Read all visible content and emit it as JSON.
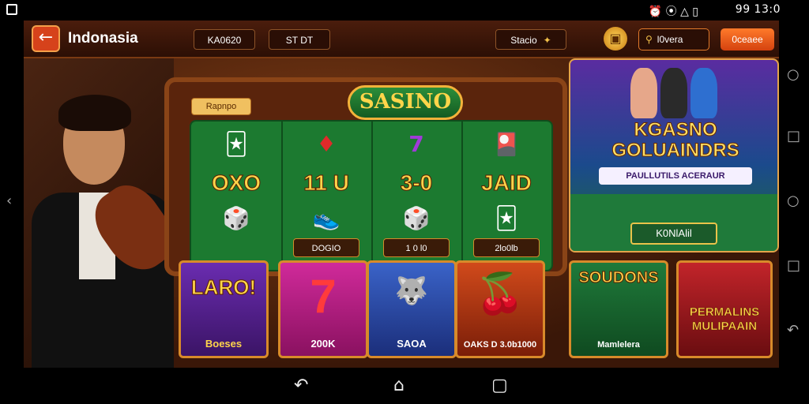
{
  "status_bar": {
    "left_icon": "notification-icon",
    "icons_text": "⏰ ⦿ △ ▯",
    "clock": "99 13:0"
  },
  "app": {
    "back_icon": "arrow-left-icon",
    "title": "Indonasia",
    "pill_1": "KA0620",
    "pill_2": "ST DT",
    "pill_3": "Stacio",
    "coin_icon": "coin-icon",
    "search_placeholder": "l0vera",
    "login_label": "0ceaee"
  },
  "slot_machine": {
    "title": "SASINO",
    "tag": "Rapnpo",
    "reels": [
      {
        "top": "🃏",
        "middle": "OXO",
        "bottom": "🎲",
        "label": ""
      },
      {
        "top": "♦",
        "middle": "11 U",
        "bottom": "👟",
        "label": "DOGIO"
      },
      {
        "top": "7",
        "middle": "3-0",
        "bottom": "🎲",
        "label": "1 0 l0"
      },
      {
        "top": "🎴",
        "middle": "JAID",
        "bottom": "🃏",
        "label": "2lo0lb"
      }
    ]
  },
  "promo": {
    "title": "KGASNO GOLUAINDRS",
    "subtitle": "PAULLUTILS ACERAUR",
    "button_label": "K0NlAlil"
  },
  "game_cards": [
    {
      "art": "LARO!",
      "label": "Boeses"
    },
    {
      "art": "7",
      "label": "200K"
    },
    {
      "art": "🐺",
      "label": "SAOA"
    },
    {
      "art": "🍒",
      "label": "OAKS D 3.0b1000"
    },
    {
      "art": "SOUDONS",
      "label": "Mamlelera"
    },
    {
      "art": "PERMALINS MULIPAAIN",
      "label": ""
    }
  ],
  "nav": {
    "back": "↶",
    "home": "⌂",
    "recents": "▢"
  },
  "colors": {
    "accent_orange": "#d6421b",
    "gold": "#ffd54a",
    "table_green": "#1c7a30",
    "frame_brown": "#8a4417"
  }
}
